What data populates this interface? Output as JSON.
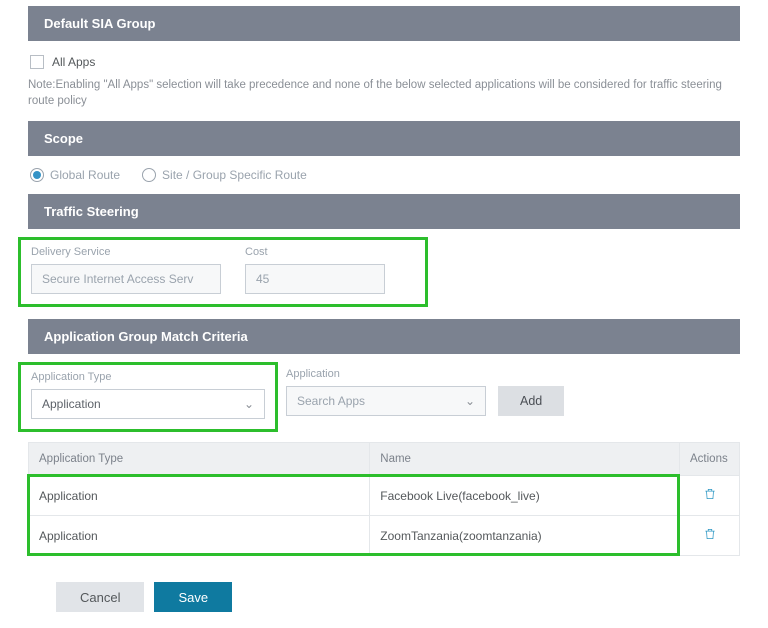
{
  "sections": {
    "default_sia": "Default SIA Group",
    "scope": "Scope",
    "traffic_steering": "Traffic Steering",
    "app_match": "Application Group Match Criteria"
  },
  "all_apps": {
    "label": "All Apps",
    "checked": false
  },
  "note": "Note:Enabling \"All Apps\" selection will take precedence and none of the below selected applications will be considered for traffic steering route policy",
  "scope": {
    "global": "Global Route",
    "site": "Site / Group Specific Route",
    "selected": "global"
  },
  "traffic_steering": {
    "delivery_service_label": "Delivery Service",
    "delivery_service_value": "Secure Internet Access Serv",
    "cost_label": "Cost",
    "cost_value": "45"
  },
  "app_match": {
    "app_type_label": "Application Type",
    "app_type_value": "Application",
    "application_label": "Application",
    "application_placeholder": "Search Apps",
    "add_label": "Add"
  },
  "table": {
    "headers": {
      "type": "Application Type",
      "name": "Name",
      "actions": "Actions"
    },
    "rows": [
      {
        "type": "Application",
        "name": "Facebook Live(facebook_live)"
      },
      {
        "type": "Application",
        "name": "ZoomTanzania(zoomtanzania)"
      }
    ]
  },
  "buttons": {
    "cancel": "Cancel",
    "save": "Save"
  }
}
